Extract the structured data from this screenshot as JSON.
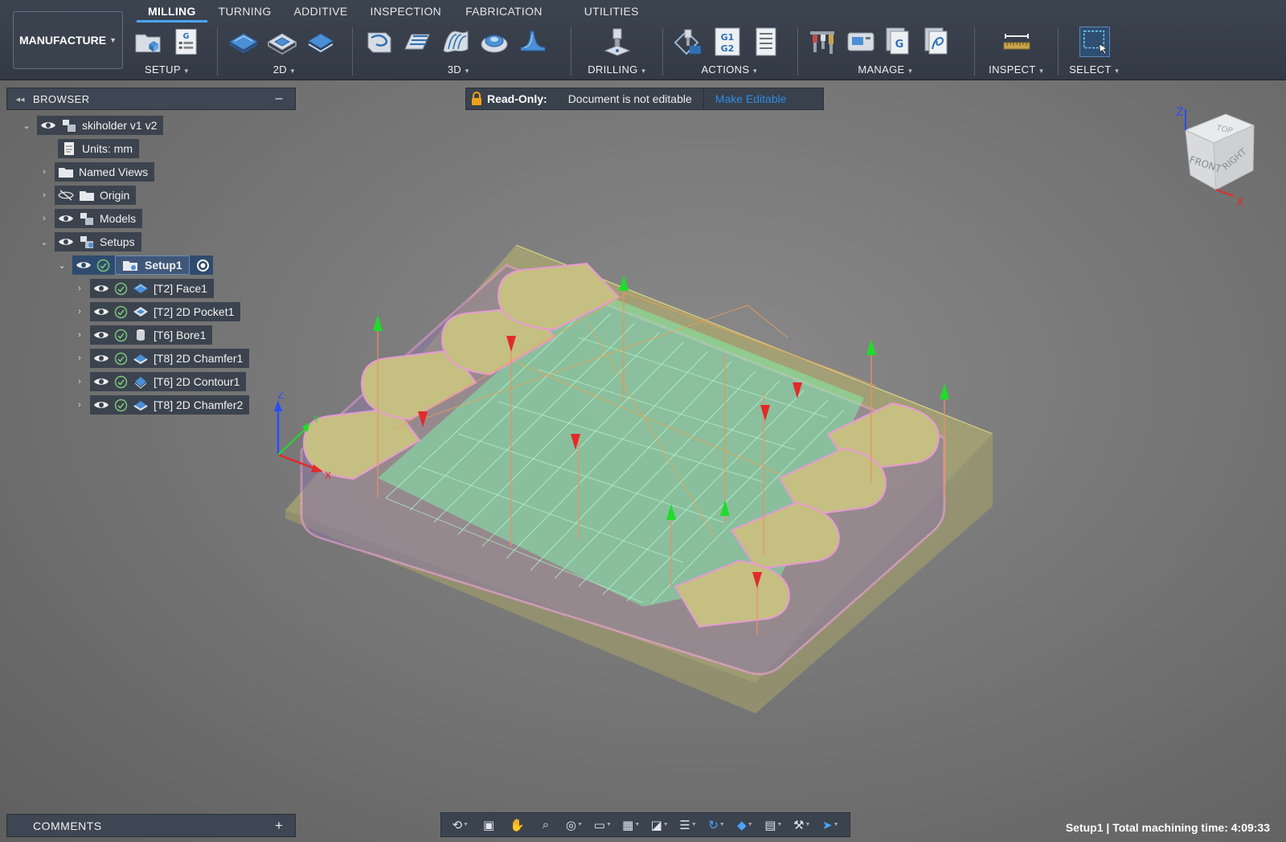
{
  "workspace": {
    "label": "MANUFACTURE"
  },
  "tabs": [
    {
      "label": "MILLING",
      "active": true
    },
    {
      "label": "TURNING"
    },
    {
      "label": "ADDITIVE"
    },
    {
      "label": "INSPECTION"
    },
    {
      "label": "FABRICATION"
    },
    {
      "label": "UTILITIES"
    }
  ],
  "groups": {
    "setup": {
      "label": "SETUP",
      "icons": [
        "new-folder-icon",
        "nc-program-icon"
      ]
    },
    "twod": {
      "label": "2D",
      "icons": [
        "face-icon",
        "pocket-icon",
        "contour-icon"
      ]
    },
    "threed": {
      "label": "3D",
      "icons": [
        "adaptive-clearing-icon",
        "steep-shallow-icon",
        "scallop-icon",
        "pocket-3d-icon",
        "flow-icon"
      ]
    },
    "drilling": {
      "label": "DRILLING",
      "icons": [
        "drill-icon"
      ]
    },
    "actions": {
      "label": "ACTIONS",
      "icons": [
        "simulate-icon",
        "post-process-icon",
        "setup-sheet-icon"
      ],
      "post_text_1": "G1",
      "post_text_2": "G2"
    },
    "manage": {
      "label": "MANAGE",
      "icons": [
        "tool-library-icon",
        "machine-library-icon",
        "post-library-icon",
        "template-library-icon"
      ]
    },
    "inspect": {
      "label": "INSPECT",
      "icons": [
        "measure-icon"
      ]
    },
    "select": {
      "label": "SELECT",
      "icons": [
        "window-select-icon"
      ]
    }
  },
  "browser": {
    "title": "BROWSER",
    "root": {
      "label": "skiholder v1 v2"
    },
    "units": {
      "label": "Units: mm"
    },
    "named_views": {
      "label": "Named Views"
    },
    "origin": {
      "label": "Origin"
    },
    "models": {
      "label": "Models"
    },
    "setups": {
      "label": "Setups"
    },
    "setup1": {
      "label": "Setup1"
    },
    "operations": [
      {
        "label": "[T2] Face1"
      },
      {
        "label": "[T2] 2D Pocket1"
      },
      {
        "label": "[T6] Bore1"
      },
      {
        "label": "[T8] 2D Chamfer1"
      },
      {
        "label": "[T6] 2D Contour1"
      },
      {
        "label": "[T8] 2D Chamfer2"
      }
    ]
  },
  "readonly": {
    "label": "Read-Only:",
    "message": "Document is not editable",
    "action": "Make Editable"
  },
  "viewcube": {
    "top": "TOP",
    "front": "FRONT",
    "right": "RIGHT",
    "axis_z": "Z",
    "axis_x": "X"
  },
  "triad": {
    "x": "X",
    "y": "Y",
    "z": "Z"
  },
  "comments": {
    "title": "COMMENTS"
  },
  "navbar": {
    "items": [
      "orbit-icon",
      "look-at-icon",
      "pan-icon",
      "zoom-icon",
      "fit-icon",
      "display-settings-icon",
      "grid-icon",
      "viewports-icon",
      "list-icon",
      "rotate-icon",
      "effects-icon",
      "camera-icon",
      "tool-icon",
      "simulation-icon"
    ]
  },
  "status": {
    "text": "Setup1 | Total machining time: 4:09:33"
  },
  "colors": {
    "accent": "#4aa3ff",
    "link": "#2f8be0",
    "lock": "#f0a020",
    "check": "#7ec47a",
    "toolpath_green": "#7dffb0",
    "toolpath_pink": "#e79ad2",
    "stock": "#c5bf82"
  }
}
